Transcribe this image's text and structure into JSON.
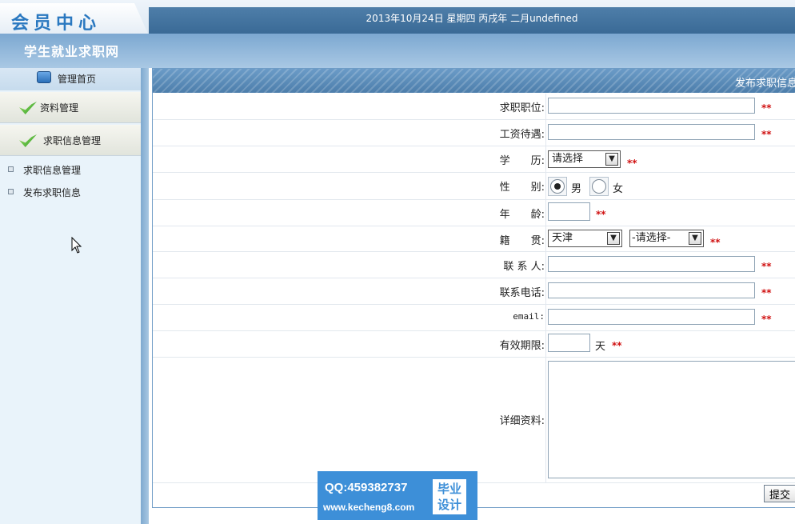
{
  "header": {
    "logo": "会员中心",
    "date": "2013年10月24日 星期四 丙戌年 二月undefined",
    "site_title": "学生就业求职网"
  },
  "sidebar": {
    "home": "管理首页",
    "menus": [
      {
        "label": "资料管理"
      },
      {
        "label": "求职信息管理"
      }
    ],
    "sub_items": [
      {
        "label": "求职信息管理"
      },
      {
        "label": "发布求职信息"
      }
    ]
  },
  "main": {
    "title": "发布求职信息",
    "required_mark": "**",
    "fields": {
      "position": {
        "label": "求职职位:",
        "value": ""
      },
      "salary": {
        "label": "工资待遇:",
        "value": ""
      },
      "education": {
        "label": "学　　历:",
        "selected": "请选择"
      },
      "gender": {
        "label": "性　　别:",
        "options": [
          "男",
          "女"
        ],
        "selected": "男"
      },
      "age": {
        "label": "年　　龄:",
        "value": ""
      },
      "hometown": {
        "label": "籍　　贯:",
        "province": "天津",
        "city": "-请选择-"
      },
      "contact": {
        "label": "联 系 人:",
        "value": ""
      },
      "phone": {
        "label": "联系电话:",
        "value": ""
      },
      "email": {
        "label": "email:",
        "value": ""
      },
      "validity": {
        "label": "有效期限:",
        "value": "",
        "unit": "天"
      },
      "details": {
        "label": "详细资料:",
        "value": ""
      }
    },
    "submit_label": "提交"
  },
  "watermark": {
    "qq": "QQ:459382737",
    "url": "www.kecheng8.com",
    "badge_line1": "毕业",
    "badge_line2": "设计"
  },
  "colors": {
    "header_blue": "#3a6a96",
    "required_red": "#d01010",
    "sidebar_bg": "#e9f3fa",
    "watermark_blue": "#3d8fd8"
  }
}
